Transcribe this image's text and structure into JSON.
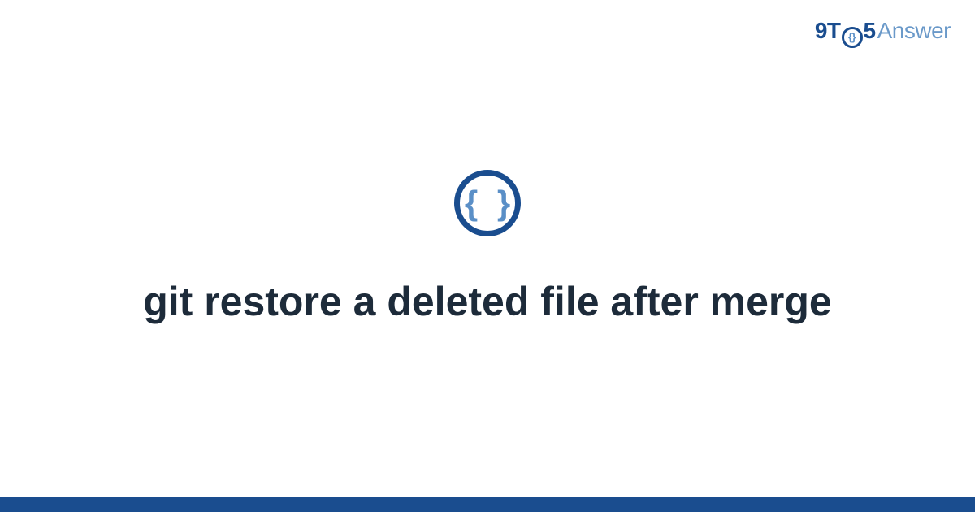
{
  "brand": {
    "prefix": "9T",
    "o_inner": "{}",
    "mid": "5",
    "suffix": "Answer"
  },
  "icon": {
    "glyph": "{ }"
  },
  "title": "git restore a deleted file after merge",
  "colors": {
    "primary": "#1a4d8f",
    "accent": "#5a8fc7",
    "text": "#1d2b3a"
  }
}
